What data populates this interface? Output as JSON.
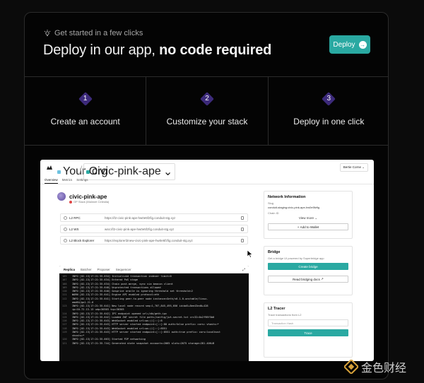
{
  "hero": {
    "eyebrow": "Get started in a few clicks",
    "title_normal": "Deploy in our app, ",
    "title_bold": "no code required",
    "deploy_label": "Deploy",
    "accent": "#2aa9a2"
  },
  "steps": [
    {
      "num": "1",
      "label": "Create an account"
    },
    {
      "num": "2",
      "label": "Customize your stack"
    },
    {
      "num": "3",
      "label": "Deploy in one click"
    }
  ],
  "preview": {
    "org": "Your Org",
    "project": "civic-pink-ape",
    "user": "Bertie Corne",
    "tabs": [
      "Overview",
      "Metrics",
      "Settings"
    ],
    "chain_name": "civic-pink-ape",
    "chain_sub": "OP Stack (Mainnet Celestia)",
    "rows": [
      {
        "k": "L2 RPC",
        "v": "https://l2-civic-pink-ape-hw0e5fzfig.conduit-stg.xyz"
      },
      {
        "k": "L2 WS",
        "v": "wss://l2-civic-pink-ape-hw0e5fzfig.conduit-stg.xyz"
      },
      {
        "k": "L2 Block Explorer",
        "v": "https://explorerl2new-civic-pink-ape-hw0e5fzfig.conduit-stg.xyz"
      }
    ],
    "term_tabs": [
      "Replica",
      "Batcher",
      "Proposer",
      "Sequencer"
    ],
    "log_lines": [
      {
        "n": "105",
        "t": "INFO [02-13|17:21:35.634] Initialized transaction indexer limit=0"
      },
      {
        "n": "107",
        "t": "INFO [02-13|17:21:35.634] Entered PoS stage"
      },
      {
        "n": "108",
        "t": "INFO [02-13|17:21:35.634] Chain post-merge, sync via beacon client"
      },
      {
        "n": "109",
        "t": "INFO [02-13|17:21:35.640] Unprotected transactions allowed"
      },
      {
        "n": "110",
        "t": "INFO [02-13|17:21:35.640] Gasprice oracle is ignoring threshold set threshold=2"
      },
      {
        "n": "111",
        "t": "WARN [02-13|17:21:35.641] Engine API enabled protocol=eth"
      },
      {
        "n": "112",
        "t": "INFO [02-13|17:21:35.641] Starting peer-to-peer node instance=Geth/v0.1.0-unstable/linux-"
      },
      {
        "n": "",
        "t": "amd64/go1.21.6"
      },
      {
        "n": "113",
        "t": "INFO [02-13|17:21:35.641] New local node record seq=1,707,845,495,056 id=bd5+8ee43ed0+428"
      },
      {
        "n": "",
        "t": "ip=10.72.13.13 udp=30303 tcp=30303"
      },
      {
        "n": "114",
        "t": "INFO [02-13|17:21:35.642] IPC endpoint opened url=/db/geth.ipc"
      },
      {
        "n": "115",
        "t": "INFO [02-13|17:21:35.642] Loaded JWT secret file path=/config/jwt-secret.txt crc32=0x2f98f5b0"
      },
      {
        "n": "116",
        "t": "INFO [02-13|17:21:35.643] WebSocket enabled url=ws://[::]:8"
      },
      {
        "n": "117",
        "t": "INFO [02-13|17:21:35.643] HTTP server started endpoint=[::]:80 auth=false prefix= cors= vhosts=*"
      },
      {
        "n": "118",
        "t": "INFO [02-13|17:21:35.643] WebSocket enabled url=ws://[::]:8551"
      },
      {
        "n": "119",
        "t": "INFO [02-13|17:21:35.643] HTTP server started endpoint=[::]:8551 auth=true prefix= cors=localhost"
      },
      {
        "n": "",
        "t": "vhosts=*"
      },
      {
        "n": "120",
        "t": "INFO [02-13|17:21:35.663] Started P2P networking"
      },
      {
        "n": "121",
        "t": "INFO [02-13|17:21:35.744] Generated state snapshot accounts=2065 slots=2075 storage=281.40KiB"
      }
    ],
    "network": {
      "title": "Network Information",
      "slug_label": "Slug",
      "slug": "conduit-staging:civic-pink-ape-hw0e5fzfig",
      "chain_id_label": "Chain ID",
      "view_more": "View more",
      "add_wallet": "Add to Wallet"
    },
    "bridge": {
      "title": "Bridge",
      "sub": "Get a bridge UI powered by Superbridge app",
      "create": "Create bridge",
      "docs": "Read bridging docs"
    },
    "tracer": {
      "title": "L2 Tracer",
      "sub": "Trace transactions from L2",
      "placeholder": "Transaction Hash",
      "button": "Trace"
    }
  },
  "watermark": {
    "text": "金色财经"
  }
}
